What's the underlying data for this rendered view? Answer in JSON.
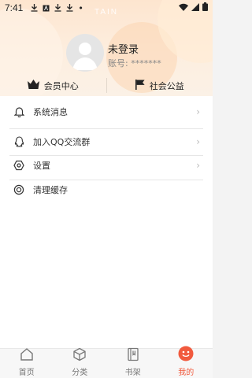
{
  "status_bar": {
    "time": "7:41",
    "dot": "•"
  },
  "app_title_ghost": "TAIN",
  "profile": {
    "name": "未登录",
    "account_label": "账号:",
    "account_value": "*******"
  },
  "quick_actions": [
    {
      "label": "会员中心",
      "icon": "crown-icon"
    },
    {
      "label": "社会公益",
      "icon": "flag-icon"
    }
  ],
  "menu": [
    {
      "label": "系统消息",
      "icon": "bell-icon",
      "has_arrow": true
    },
    {
      "label": "加入QQ交流群",
      "icon": "qq-icon",
      "has_arrow": true
    },
    {
      "label": "设置",
      "icon": "settings-icon",
      "has_arrow": true
    },
    {
      "label": "清理缓存",
      "icon": "clear-cache-icon",
      "has_arrow": false
    }
  ],
  "tabs": [
    {
      "label": "首页",
      "icon": "home-icon",
      "active": false
    },
    {
      "label": "分类",
      "icon": "category-box-icon",
      "active": false
    },
    {
      "label": "书架",
      "icon": "bookshelf-icon",
      "active": false
    },
    {
      "label": "我的",
      "icon": "smiley-face-icon",
      "active": true
    }
  ],
  "colors": {
    "accent": "#f15a3e",
    "header_bg": "#fde5cf",
    "text": "#333333"
  }
}
